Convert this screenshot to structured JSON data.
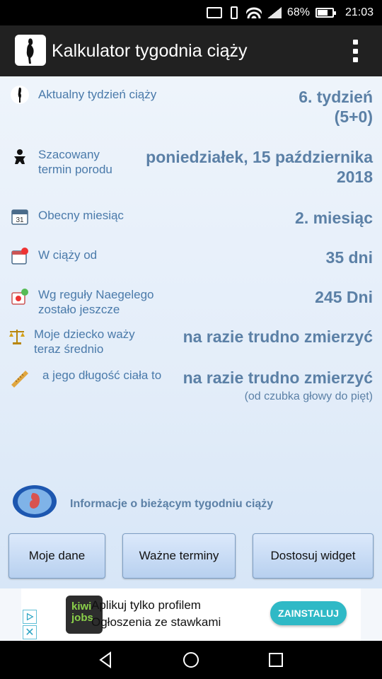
{
  "status_bar": {
    "battery": "68%",
    "battery_level": 0.68,
    "time": "21:03",
    "icons": [
      "cast-icon",
      "vibrate-icon",
      "wifi-icon",
      "signal-icon",
      "battery-icon"
    ]
  },
  "app_bar": {
    "title": "Kalkulator tygodnia ciąży",
    "icon": "pregnancy-silhouette-icon",
    "menu_icon": "overflow-menu-icon"
  },
  "rows": [
    {
      "icon": "silhouette-icon",
      "label": "Aktualny tydzień ciąży",
      "value_line1": "6. tydzień",
      "value_line2": "(5+0)"
    },
    {
      "icon": "baby-icon",
      "label_line1": "Szacowany",
      "label_line2": "termin porodu",
      "value_line1": "poniedziałek, 15 października",
      "value_line2": "2018"
    },
    {
      "icon": "calendar-icon",
      "label": "Obecny miesiąc",
      "value": "2. miesiąc"
    },
    {
      "icon": "calendar-alert-icon",
      "label": "W ciąży od",
      "value": "35 dni"
    },
    {
      "icon": "calendar-add-icon",
      "label_line1": "Wg reguły Naegelego",
      "label_line2": "zostało jeszcze",
      "value": "245 Dni"
    },
    {
      "icon": "scale-icon",
      "label_line1": "Moje dziecko waży",
      "label_line2": "teraz średnio",
      "value": "na razie trudno zmierzyć"
    },
    {
      "icon": "ruler-icon",
      "label": "a jego długość ciała to",
      "value": "na razie trudno zmierzyć",
      "note": "(od czubka głowy do pięt)"
    }
  ],
  "info": {
    "icon": "fetus-icon",
    "text": "Informacje o bieżącym tygodniu ciąży"
  },
  "buttons": {
    "my_data": "Moje dane",
    "important_dates": "Ważne terminy",
    "customize_widget": "Dostosuj widget"
  },
  "ad": {
    "logo_line1": "kiwi",
    "logo_line2": "jobs",
    "line1": "Aplikuj tylko profilem",
    "line2": "Ogłoszenia ze stawkami",
    "cta": "ZAINSTALUJ",
    "badges": [
      "adchoices-play-icon",
      "close-icon"
    ],
    "colors": {
      "cta": "#2fb9c6",
      "logo_bg": "#2d2d2d",
      "logo_text": "#8bd14a"
    }
  },
  "nav_bar": {
    "icons": [
      "back-icon",
      "home-icon",
      "recents-icon"
    ]
  },
  "colors": {
    "app_bar": "#212121",
    "label_text": "#4a7aaa",
    "value_text": "#5b80a6",
    "content_bg": "#e3edf9"
  }
}
